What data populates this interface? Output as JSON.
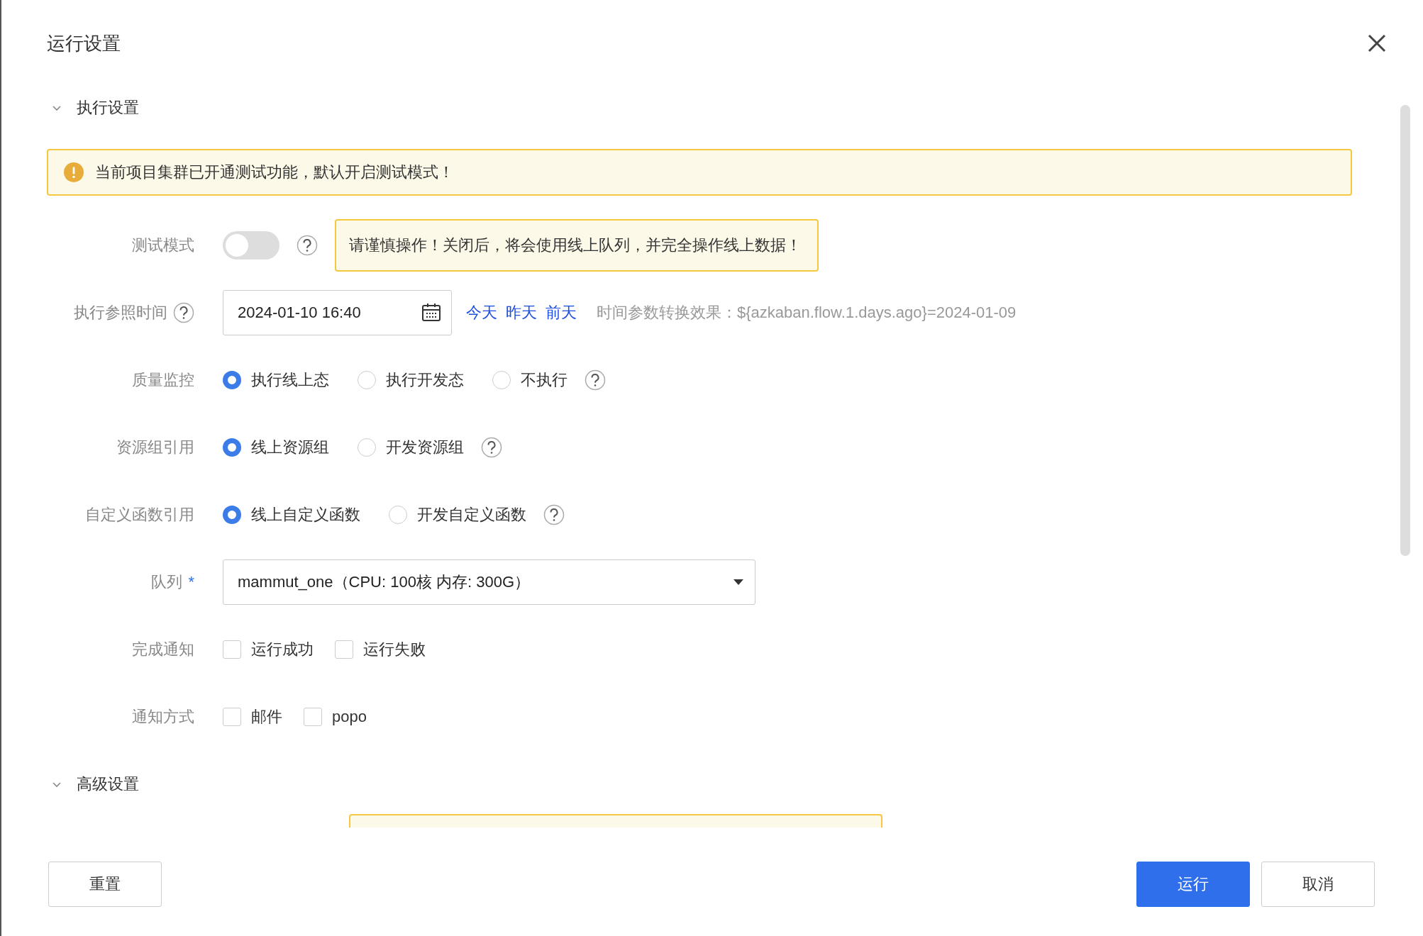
{
  "dialog": {
    "title": "运行设置"
  },
  "sections": [
    {
      "title": "执行设置",
      "expanded": true
    },
    {
      "title": "高级设置",
      "expanded": true
    }
  ],
  "alert": {
    "text": "当前项目集群已开通测试功能，默认开启测试模式！"
  },
  "fields": [
    {
      "kind": "toggle",
      "label": "测试模式",
      "on": false,
      "help": true,
      "warning": "请谨慎操作！关闭后，将会使用线上队列，并完全操作线上数据！"
    },
    {
      "kind": "datetime",
      "label": "执行参照时间",
      "label_help": true,
      "value": "2024-01-10 16:40",
      "shortcuts": [
        "今天",
        "昨天",
        "前天"
      ],
      "hint": "时间参数转换效果：${azkaban.flow.1.days.ago}=2024-01-09"
    },
    {
      "kind": "radio",
      "label": "质量监控",
      "help": true,
      "options": [
        {
          "label": "执行线上态",
          "selected": true
        },
        {
          "label": "执行开发态",
          "selected": false
        },
        {
          "label": "不执行",
          "selected": false
        }
      ]
    },
    {
      "kind": "radio",
      "label": "资源组引用",
      "help": true,
      "options": [
        {
          "label": "线上资源组",
          "selected": true
        },
        {
          "label": "开发资源组",
          "selected": false
        }
      ]
    },
    {
      "kind": "radio",
      "label": "自定义函数引用",
      "help": true,
      "options": [
        {
          "label": "线上自定义函数",
          "selected": true
        },
        {
          "label": "开发自定义函数",
          "selected": false
        }
      ]
    },
    {
      "kind": "select",
      "label": "队列",
      "required": true,
      "required_mark": "*",
      "value": "mammut_one（CPU: 100核 内存: 300G）"
    },
    {
      "kind": "checkbox",
      "label": "完成通知",
      "options": [
        {
          "label": "运行成功",
          "checked": false
        },
        {
          "label": "运行失败",
          "checked": false
        }
      ]
    },
    {
      "kind": "checkbox",
      "label": "通知方式",
      "options": [
        {
          "label": "邮件",
          "checked": false
        },
        {
          "label": "popo",
          "checked": false
        }
      ]
    }
  ],
  "footer": {
    "left": [
      {
        "label": "重置",
        "kind": "default"
      }
    ],
    "right": [
      {
        "label": "运行",
        "kind": "primary"
      },
      {
        "label": "取消",
        "kind": "default"
      }
    ]
  }
}
